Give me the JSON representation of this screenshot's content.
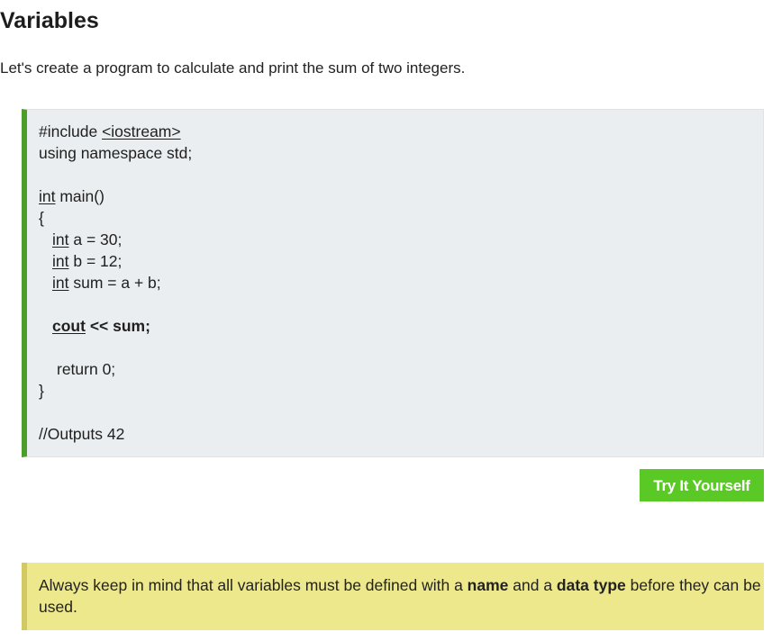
{
  "lesson": {
    "title": "Variables",
    "intro": "Let's create a program to calculate and print the sum of two integers."
  },
  "code": {
    "include_directive": "#include ",
    "include_header": "<iostream>",
    "using_line": "using namespace std;",
    "int_kw": "int",
    "main_sig": " main()",
    "open_brace": "{",
    "decl_a": " a = 30;",
    "decl_b": " b = 12;",
    "decl_sum": " sum = a + b;",
    "cout_kw": "cout",
    "cout_rest": " << sum;",
    "return_line": "return 0;",
    "close_brace": "}",
    "comment": "//Outputs 42"
  },
  "actions": {
    "try_label": "Try It Yourself"
  },
  "note": {
    "part1": "Always keep in mind that all variables must be defined with a ",
    "bold1": "name",
    "part2": " and a ",
    "bold2": "data type",
    "part3": " before they can be used."
  },
  "colors": {
    "code_bg": "#eaeef0",
    "code_accent": "#4c9e2c",
    "button_bg": "#5ac825",
    "note_bg": "#eee88c",
    "note_accent": "#d2c965"
  }
}
